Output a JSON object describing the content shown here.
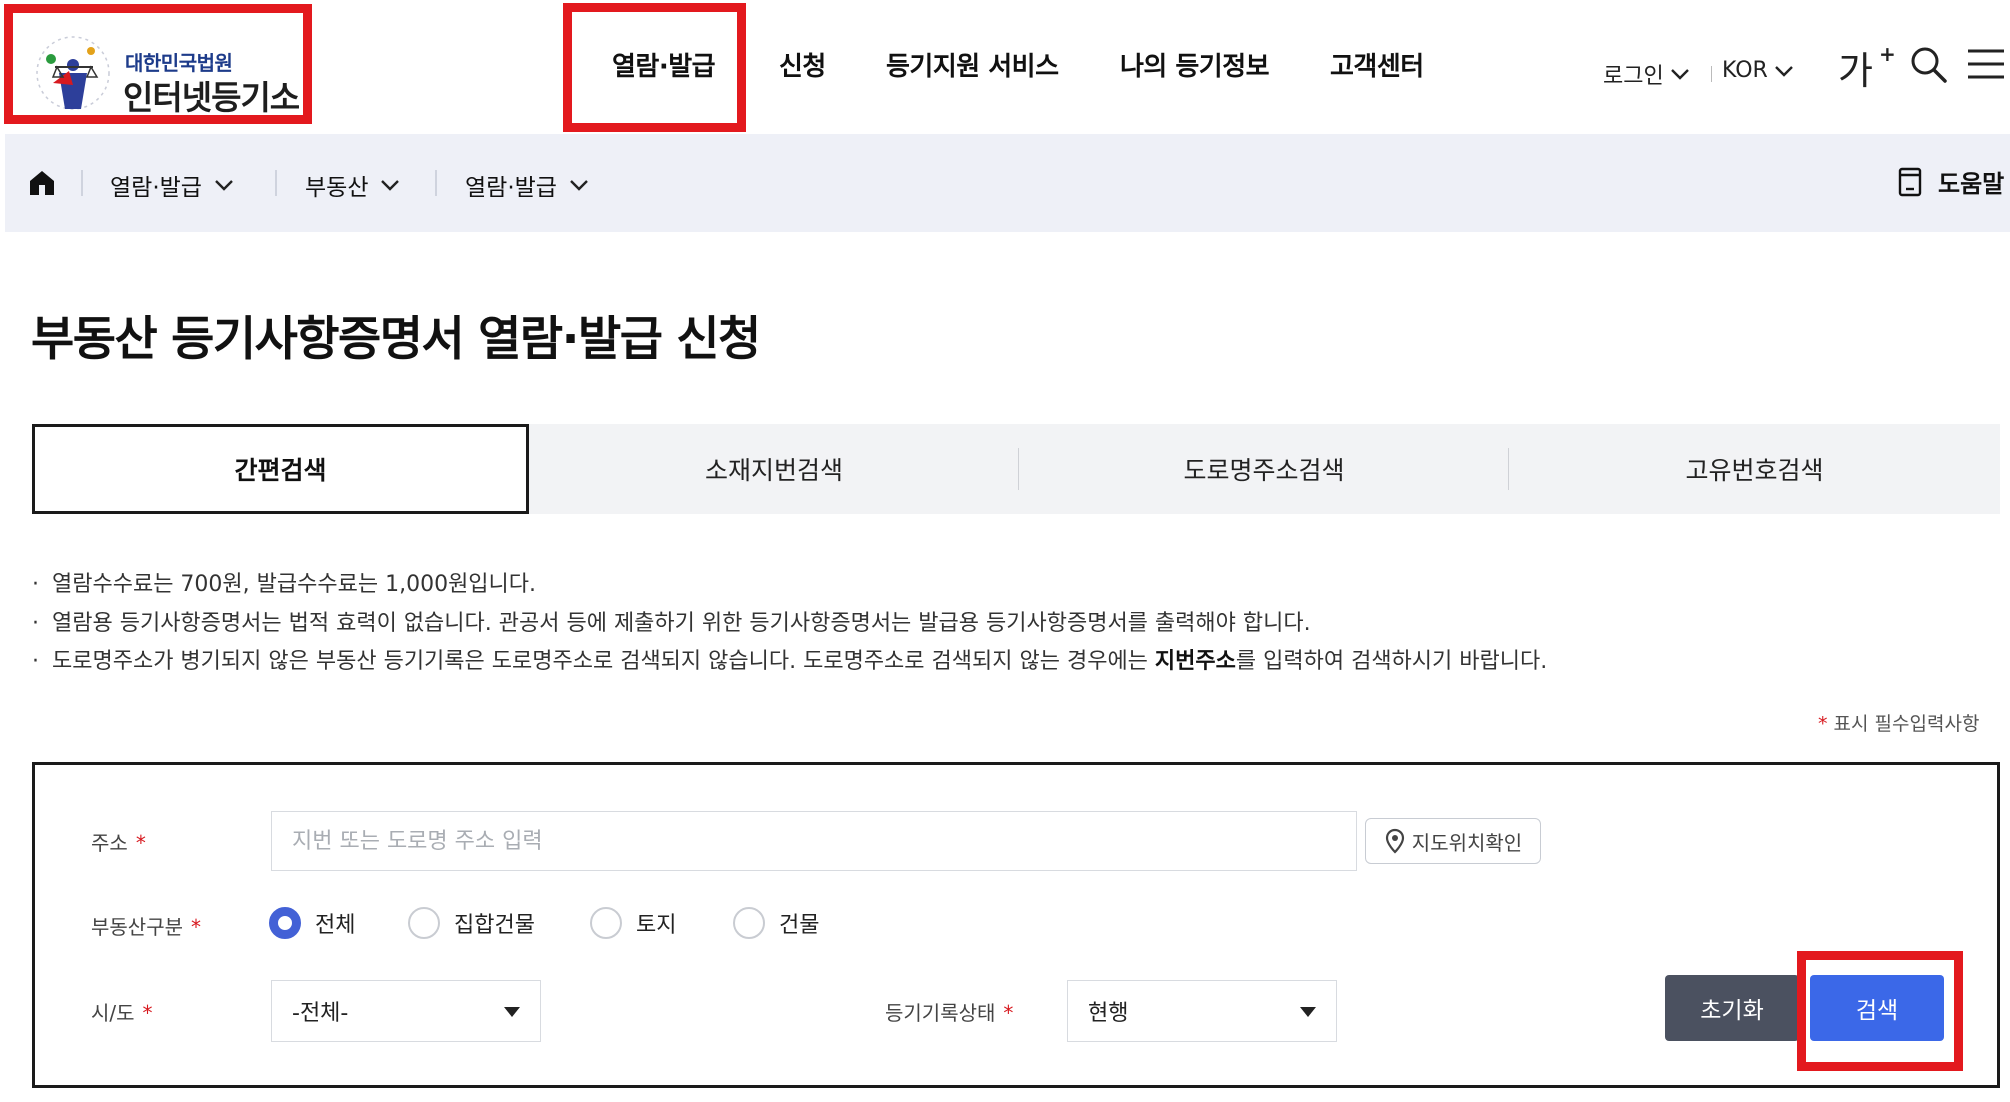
{
  "header": {
    "logo": {
      "small_text": "대한민국법원",
      "big_text": "인터넷등기소"
    },
    "nav": [
      {
        "label": "열람·발급"
      },
      {
        "label": "신청"
      },
      {
        "label": "등기지원 서비스"
      },
      {
        "label": "나의 등기정보"
      },
      {
        "label": "고객센터"
      }
    ],
    "utility": {
      "login": "로그인",
      "language": "KOR",
      "font_size": "가",
      "font_size_plus": "+"
    }
  },
  "breadcrumb": {
    "items": [
      {
        "label": "열람·발급"
      },
      {
        "label": "부동산"
      },
      {
        "label": "열람·발급"
      }
    ],
    "help": "도움말"
  },
  "page": {
    "title": "부동산 등기사항증명서 열람·발급 신청"
  },
  "tabs": [
    {
      "label": "간편검색",
      "active": true
    },
    {
      "label": "소재지번검색",
      "active": false
    },
    {
      "label": "도로명주소검색",
      "active": false
    },
    {
      "label": "고유번호검색",
      "active": false
    }
  ],
  "notices": [
    {
      "text": "열람수수료는  700원, 발급수수료는  1,000원입니다."
    },
    {
      "text": "열람용 등기사항증명서는 법적 효력이 없습니다. 관공서 등에 제출하기 위한 등기사항증명서는 발급용 등기사항증명서를 출력해야 합니다."
    },
    {
      "text_before": "도로명주소가 병기되지 않은 부동산 등기기록은 도로명주소로 검색되지 않습니다. 도로명주소로 검색되지 않는 경우에는 ",
      "text_bold": "지번주소",
      "text_after": "를 입력하여 검색하시기 바랍니다."
    }
  ],
  "required_note": {
    "star": "*",
    "text": "표시 필수입력사항"
  },
  "form": {
    "address": {
      "label": "주소",
      "placeholder": "지번 또는 도로명 주소 입력",
      "value": "",
      "map_button": "지도위치확인"
    },
    "property_type": {
      "label": "부동산구분",
      "options": [
        {
          "label": "전체",
          "checked": true
        },
        {
          "label": "집합건물",
          "checked": false
        },
        {
          "label": "토지",
          "checked": false
        },
        {
          "label": "건물",
          "checked": false
        }
      ]
    },
    "region": {
      "label": "시/도",
      "selected": "-전체-"
    },
    "record_status": {
      "label": "등기기록상태",
      "selected": "현행"
    },
    "required_star": "*",
    "reset_button": "초기화",
    "search_button": "검색"
  },
  "colors": {
    "highlight": "#e3191e",
    "primary": "#3b68e8",
    "dark_button": "#4b5160",
    "radio_checked": "#4361d6",
    "breadcrumb_bg": "#eef0f7"
  }
}
